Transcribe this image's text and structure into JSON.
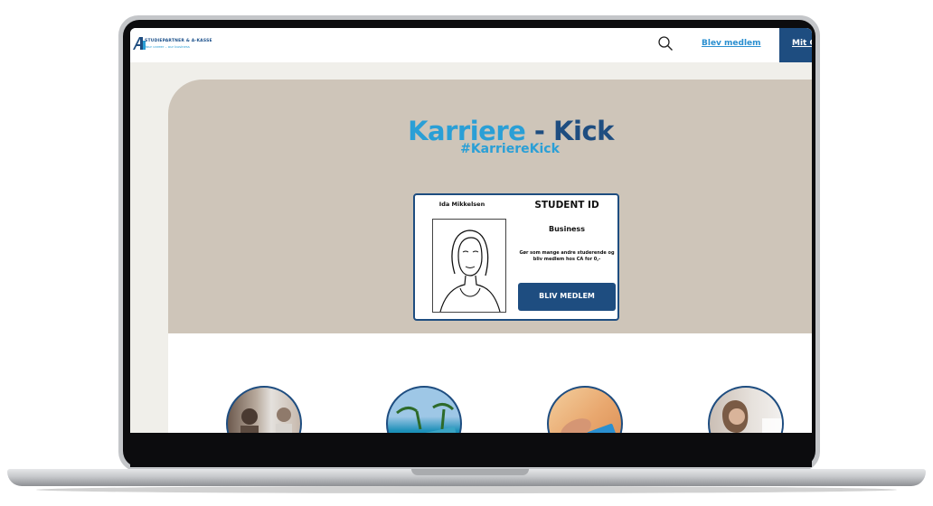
{
  "header": {
    "logo_line1": "STUDIEPARTNER & A-KASSE",
    "logo_line2": "Your career – our business",
    "join_link": "Blev medlem",
    "account_button": "Mit C"
  },
  "hero": {
    "title_part1": "Karriere",
    "title_part2": " - Kick",
    "hashtag": "#KarriereKick"
  },
  "student_card": {
    "name": "Ida Mikkelsen",
    "id_title": "STUDENT ID",
    "program": "Business",
    "promo_text": "Gør som mange andre studerende og bliv medlem hos CA for 0,-",
    "cta_button": "BLIV MEDLEM"
  },
  "colors": {
    "brand_dark": "#1e4d80",
    "brand_light": "#2a9fd6",
    "hero_background": "#cec5b9"
  },
  "thumbnails": [
    "people-photo",
    "beach-photo",
    "card-in-hand-photo",
    "woman-photo"
  ]
}
